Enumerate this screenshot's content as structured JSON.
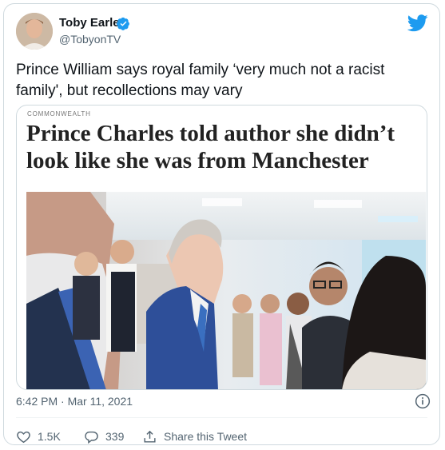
{
  "author": {
    "name": "Toby Earle",
    "handle": "@TobyonTV"
  },
  "tweet": {
    "text": "Prince William says royal family ‘very much not a racist family', but recollections may vary"
  },
  "media": {
    "kicker": "COMMONWEALTH",
    "headline": "Prince Charles told author she didn’t look like she was from Manchester"
  },
  "meta": {
    "timestamp": "6:42 PM · Mar 11, 2021"
  },
  "actions": {
    "like_count": "1.5K",
    "reply_count": "339",
    "share_label": "Share this Tweet"
  },
  "colors": {
    "twitter_blue": "#1d9bf0",
    "text_secondary": "#536471",
    "border": "#cfd9de"
  },
  "icons": [
    "verified-badge-icon",
    "twitter-bird-icon",
    "info-icon",
    "heart-icon",
    "reply-icon",
    "share-icon"
  ]
}
